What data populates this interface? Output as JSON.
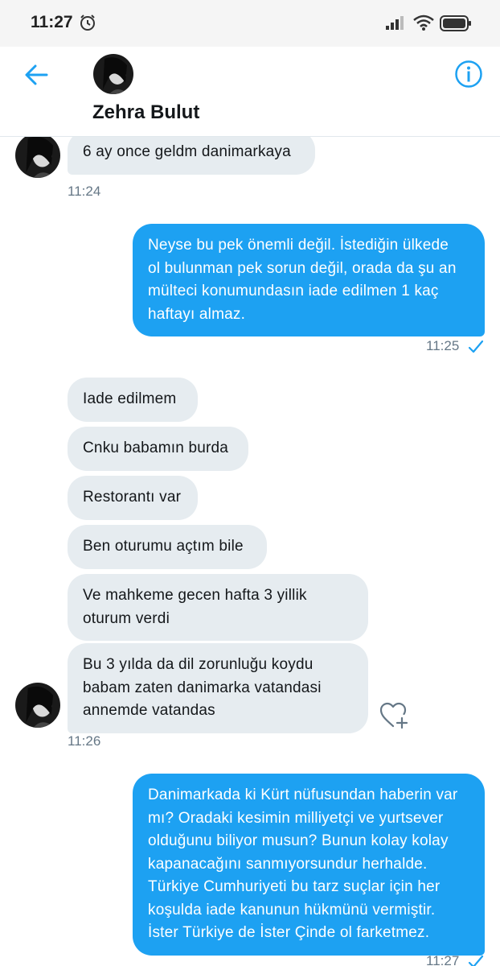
{
  "status_bar": {
    "time": "11:27"
  },
  "header": {
    "contact_name": "Zehra Bulut"
  },
  "colors": {
    "accent": "#1da1f2",
    "incoming_bubble": "#e6ecf0",
    "timestamp": "#657786"
  },
  "icons": [
    "alarm-icon",
    "signal-icon",
    "wifi-icon",
    "battery-icon",
    "back-arrow-icon",
    "info-icon",
    "checkmark-icon",
    "heart-plus-icon"
  ],
  "messages": [
    {
      "dir": "in",
      "lines": [
        "6 ay once geldm danimarkaya"
      ]
    },
    {
      "dir": "out",
      "lines": [
        "Neyse bu pek önemli değil. İstediğin ülkede",
        "ol bulunman pek sorun değil, orada da şu an",
        "mülteci konumundasın iade edilmen 1 kaç",
        "haftayı almaz."
      ]
    },
    {
      "dir": "in",
      "lines": [
        "Iade edilmem"
      ]
    },
    {
      "dir": "in",
      "lines": [
        "Cnku babamın burda"
      ]
    },
    {
      "dir": "in",
      "lines": [
        "Restorantı var"
      ]
    },
    {
      "dir": "in",
      "lines": [
        "Ben oturumu açtım bile"
      ]
    },
    {
      "dir": "in",
      "lines": [
        "Ve mahkeme gecen hafta 3 yillik",
        "oturum verdi"
      ]
    },
    {
      "dir": "in",
      "lines": [
        "Bu 3 yılda da dil zorunluğu koydu",
        "babam zaten danimarka vatandasi",
        "annemde vatandas"
      ]
    },
    {
      "dir": "out",
      "lines": [
        "Danimarkada ki Kürt nüfusundan haberin var",
        "mı? Oradaki kesimin milliyetçi ve yurtsever",
        "olduğunu biliyor musun? Bunun kolay kolay",
        "kapanacağını sanmıyorsundur herhalde.",
        "Türkiye Cumhuriyeti bu tarz suçlar için her",
        "koşulda iade kanunun hükmünü vermiştir.",
        "İster Türkiye de İster Çinde ol farketmez."
      ]
    }
  ],
  "timestamps": [
    "11:24",
    "11:25",
    "11:26",
    "11:27"
  ]
}
